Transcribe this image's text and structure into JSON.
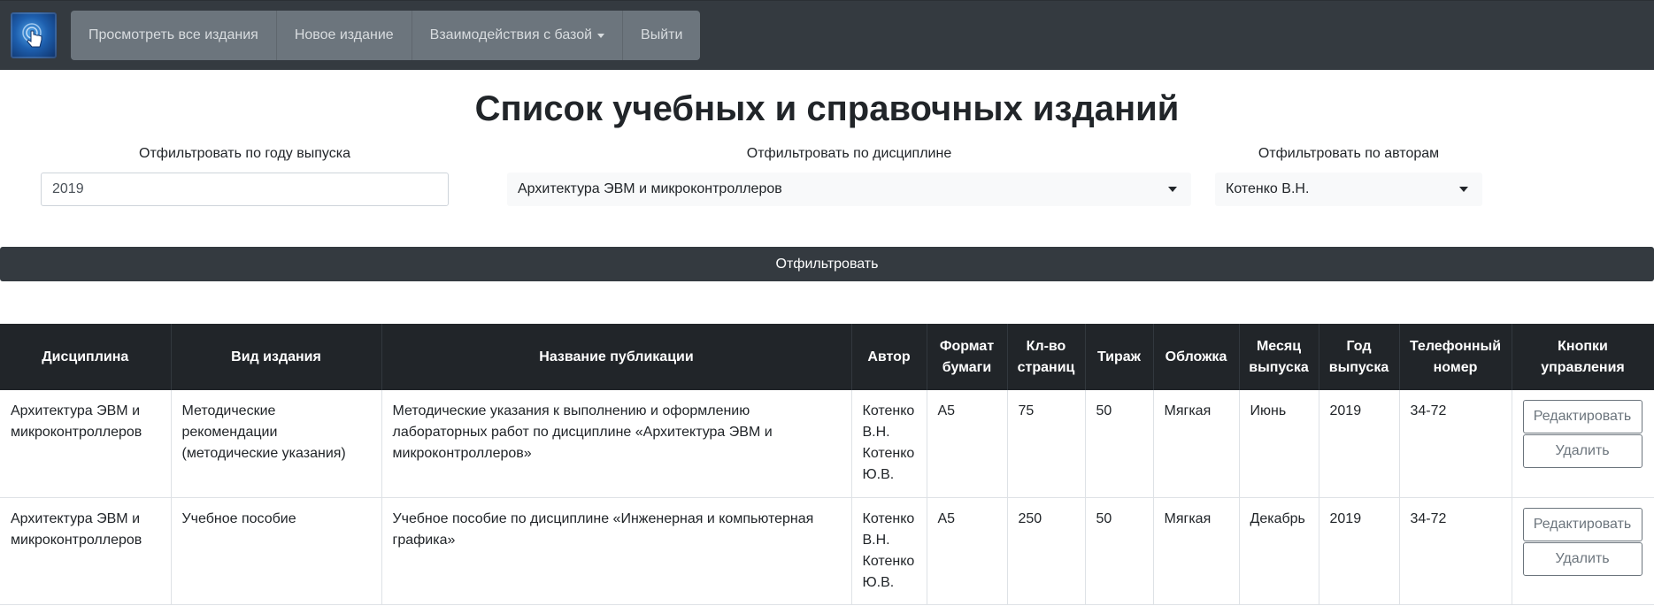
{
  "navbar": {
    "logo_icon": "touch-hand-icon",
    "items": [
      {
        "label": "Просмотреть все издания"
      },
      {
        "label": "Новое издание"
      },
      {
        "label": "Взаимодействия с базой",
        "dropdown": true
      },
      {
        "label": "Выйти"
      }
    ]
  },
  "page": {
    "title": "Список учебных и справочных изданий"
  },
  "filters": {
    "year": {
      "label": "Отфильтровать по году выпуска",
      "value": "2019"
    },
    "discipline": {
      "label": "Отфильтровать по дисциплине",
      "value": "Архитектура ЭВМ и микроконтроллеров"
    },
    "authors": {
      "label": "Отфильтровать по авторам",
      "value": "Котенко В.Н."
    },
    "submit_label": "Отфильтровать"
  },
  "table": {
    "headers": [
      "Дисциплина",
      "Вид издания",
      "Название публикации",
      "Автор",
      "Формат бумаги",
      "Кл-во страниц",
      "Тираж",
      "Обложка",
      "Месяц выпуска",
      "Год выпуска",
      "Телефонный номер",
      "Кнопки управления"
    ],
    "rows": [
      {
        "discipline": "Архитектура ЭВМ и микроконтроллеров",
        "type": "Методические рекомендации (методические указания)",
        "title": "Методические указания к выполнению и оформлению лабораторных работ по дисциплине «Архитектура ЭВМ и микроконтроллеров»",
        "author": "Котенко В.Н. Котенко Ю.В.",
        "format": "А5",
        "pages": "75",
        "copies": "50",
        "cover": "Мягкая",
        "month": "Июнь",
        "year": "2019",
        "phone": "34-72",
        "edit_label": "Редактировать",
        "delete_label": "Удалить"
      },
      {
        "discipline": "Архитектура ЭВМ и микроконтроллеров",
        "type": "Учебное пособие",
        "title": "Учебное пособие по дисциплине «Инженерная и компьютерная графика»",
        "author": "Котенко В.Н. Котенко Ю.В.",
        "format": "А5",
        "pages": "250",
        "copies": "50",
        "cover": "Мягкая",
        "month": "Декабрь",
        "year": "2019",
        "phone": "34-72",
        "edit_label": "Редактировать",
        "delete_label": "Удалить"
      }
    ]
  }
}
